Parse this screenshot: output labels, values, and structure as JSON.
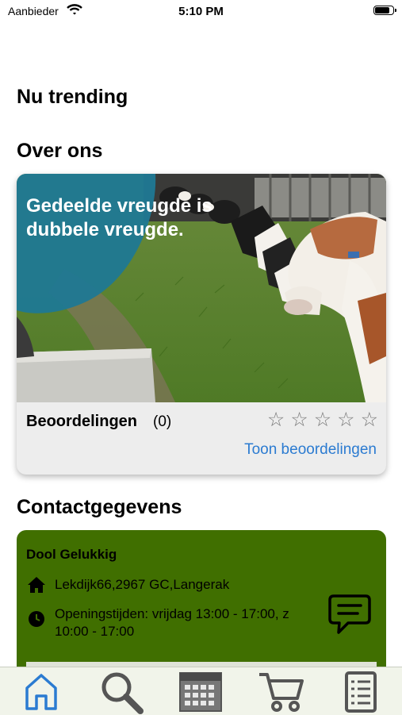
{
  "status_bar": {
    "carrier": "Aanbieder",
    "time": "5:10 PM",
    "battery_level": 0.9
  },
  "sections": {
    "trending_title": "Nu trending",
    "about_title": "Over ons",
    "contact_title": "Contactgegevens"
  },
  "about_card": {
    "slogan": "Gedeelde vreugde is dubbele vreugde.",
    "reviews_label": "Beoordelingen",
    "reviews_count": "(0)",
    "rating": 0,
    "max_rating": 5,
    "show_reviews_link": "Toon beoordelingen"
  },
  "contact_card": {
    "name": "Dool Gelukkig",
    "address": "Lekdijk66,2967 GC,Langerak",
    "opening_hours": "Openingstijden: vrijdag 13:00 - 17:00, z 10:00 - 17:00",
    "chat_icon": "chat-bubble-icon"
  },
  "tab_bar": {
    "active_color": "#2b7bd1",
    "items": [
      {
        "name": "home",
        "icon": "home-icon",
        "active": true
      },
      {
        "name": "search",
        "icon": "search-icon",
        "active": false
      },
      {
        "name": "calendar",
        "icon": "calendar-icon",
        "active": false
      },
      {
        "name": "cart",
        "icon": "cart-icon",
        "active": false
      },
      {
        "name": "orders",
        "icon": "list-icon",
        "active": false
      }
    ]
  },
  "colors": {
    "contact_bg": "#406f00",
    "link": "#2b7bd1",
    "slogan_blob": "#1f7893"
  }
}
